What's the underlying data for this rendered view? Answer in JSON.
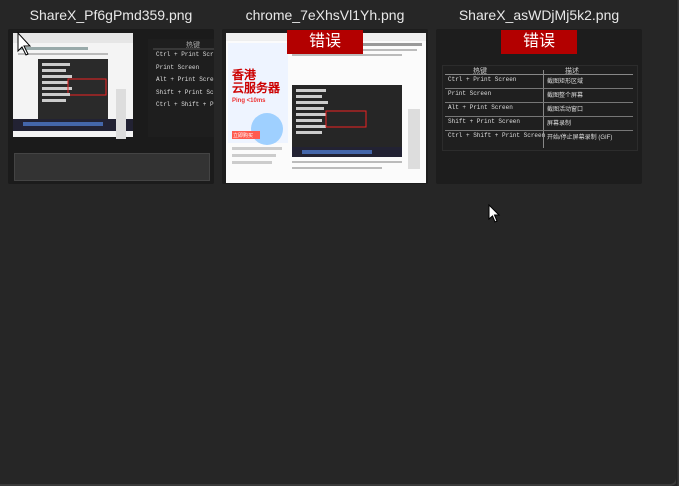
{
  "files": [
    {
      "name": "ShareX_Pf6gPmd359.png",
      "error": ""
    },
    {
      "name": "chrome_7eXhsVl1Yh.png",
      "error": "错误"
    },
    {
      "name": "ShareX_asWDjMj5k2.png",
      "error": "错误"
    }
  ],
  "thumb1": {
    "hotkeys_header": "热键",
    "hotkeys": [
      "Ctrl + Print Screen",
      "Print Screen",
      "Alt + Print Screen",
      "Shift + Print Screen",
      "Ctrl + Shift + Print"
    ]
  },
  "thumb2": {
    "ad_title": "香港",
    "ad_title2": "云服务器",
    "ad_ping": "Ping <10ms",
    "ad_button": "立即购买"
  },
  "thumb3": {
    "col_hotkey": "热键",
    "col_desc": "描述",
    "rows": [
      {
        "key": "Ctrl + Print Screen",
        "desc": "截图矩形区域"
      },
      {
        "key": "Print Screen",
        "desc": "截图整个屏幕"
      },
      {
        "key": "Alt + Print Screen",
        "desc": "截图活动窗口"
      },
      {
        "key": "Shift + Print Screen",
        "desc": "屏幕录制"
      },
      {
        "key": "Ctrl + Shift + Print Screen",
        "desc": "开始/停止屏幕录制 (GIF)"
      }
    ]
  }
}
